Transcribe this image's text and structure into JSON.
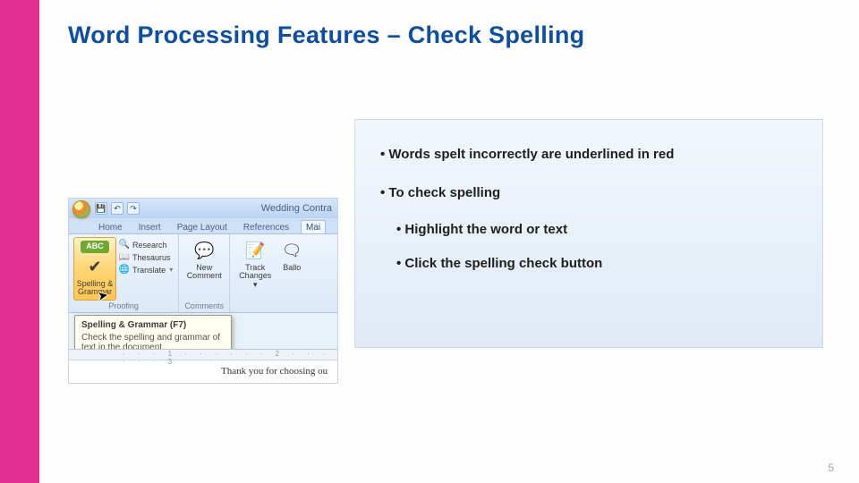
{
  "slide": {
    "title": "Word Processing Features – Check Spelling",
    "page_number": "5"
  },
  "info": {
    "b0": "Words spelt incorrectly are underlined in red",
    "b1": "To check spelling",
    "b2": "Highlight the word or text",
    "b3": "Click the spelling check button"
  },
  "word_shot": {
    "doc_title": "Wedding Contra",
    "tabs": {
      "home": "Home",
      "insert": "Insert",
      "page_layout": "Page Layout",
      "references": "References",
      "mailings": "Mai"
    },
    "groups": {
      "proofing": {
        "label": "Proofing",
        "spelling_grammar_abc": "ABC",
        "spelling_grammar_label": "Spelling & Grammar",
        "research": "Research",
        "thesaurus": "Thesaurus",
        "translate": "Translate"
      },
      "comments": {
        "label": "Comments",
        "new_comment": "New Comment"
      },
      "tracking": {
        "track_changes": "Track Changes",
        "balloons": "Ballo"
      }
    },
    "tooltip": {
      "title": "Spelling & Grammar (F7)",
      "body": "Check the spelling and grammar of text in the document."
    },
    "doc_text": "Thank you for choosing ou"
  }
}
